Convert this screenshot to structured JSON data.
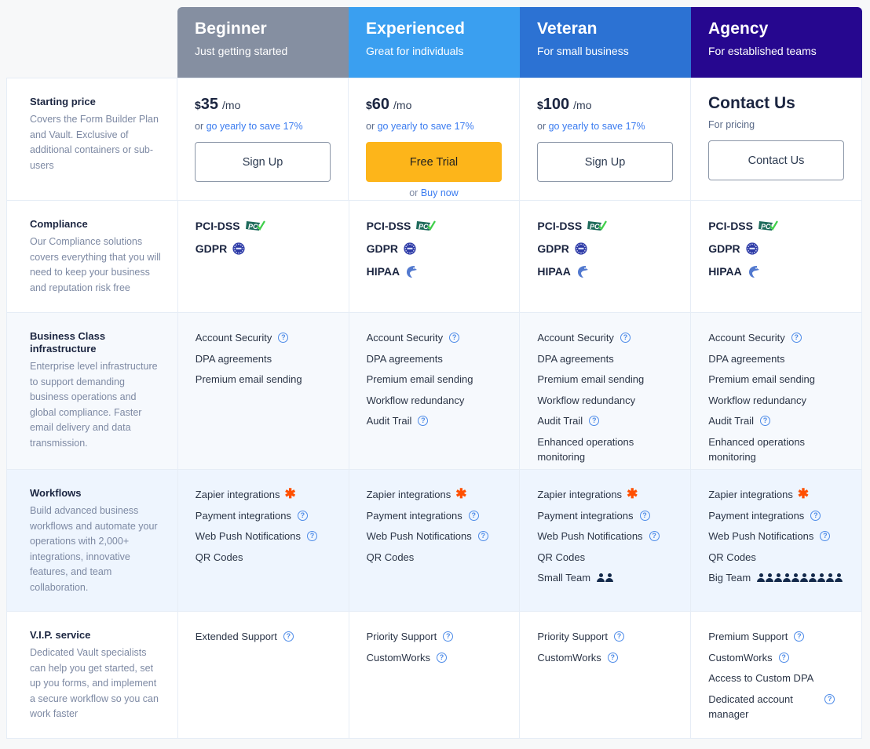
{
  "plans": [
    {
      "name": "Beginner",
      "tagline": "Just getting started",
      "color": "#858fa1",
      "currency": "$",
      "amount": "35",
      "per": "/mo",
      "yearly_prefix": "or",
      "yearly_link": "go yearly to save 17%",
      "button": "Sign Up"
    },
    {
      "name": "Experienced",
      "tagline": "Great for individuals",
      "color": "#3a9ff0",
      "currency": "$",
      "amount": "60",
      "per": "/mo",
      "yearly_prefix": "or",
      "yearly_link": "go yearly to save 17%",
      "button": "Free Trial",
      "buy_prefix": "or",
      "buy_link": "Buy now"
    },
    {
      "name": "Veteran",
      "tagline": "For small business",
      "color": "#2c72d3",
      "currency": "$",
      "amount": "100",
      "per": "/mo",
      "yearly_prefix": "or",
      "yearly_link": "go yearly to save 17%",
      "button": "Sign Up"
    },
    {
      "name": "Agency",
      "tagline": "For established teams",
      "color": "#26078f",
      "contact_title": "Contact Us",
      "for_pricing": "For pricing",
      "button": "Contact Us"
    }
  ],
  "rows": {
    "pricing": {
      "title": "Starting price",
      "desc": "Covers the Form Builder Plan and Vault. Exclusive of additional containers or sub-users"
    },
    "compliance": {
      "title": "Compliance",
      "desc": "Our Compliance solutions covers everything that you will need to keep your business and reputation risk free",
      "labels": {
        "pci": "PCI-DSS",
        "gdpr": "GDPR",
        "hipaa": "HIPAA"
      },
      "icons": {
        "pci": "pci-badge-icon",
        "gdpr": "gdpr-eu-seal-icon",
        "hipaa": "hipaa-eagle-icon"
      }
    },
    "infra": {
      "title": "Business Class infrastructure",
      "desc": "Enterprise level infrastructure to support demanding business operations and global compliance. Faster email delivery and data transmission."
    },
    "workflows": {
      "title": "Workflows",
      "desc": "Build advanced business workflows and automate your operations with 2,000+ integrations, innovative features, and team collaboration."
    },
    "vip": {
      "title": "V.I.P. service",
      "desc": "Dedicated Vault specialists can help you get started, set up you forms, and implement a secure workflow so you can work faster"
    }
  },
  "compliance_columns": [
    [
      "pci",
      "gdpr"
    ],
    [
      "pci",
      "gdpr",
      "hipaa"
    ],
    [
      "pci",
      "gdpr",
      "hipaa"
    ],
    [
      "pci",
      "gdpr",
      "hipaa"
    ]
  ],
  "infra_columns": [
    [
      {
        "label": "Account Security",
        "help": true
      },
      {
        "label": "DPA agreements"
      },
      {
        "label": "Premium email sending"
      }
    ],
    [
      {
        "label": "Account Security",
        "help": true
      },
      {
        "label": "DPA agreements"
      },
      {
        "label": "Premium email sending"
      },
      {
        "label": "Workflow redundancy"
      },
      {
        "label": "Audit Trail",
        "help": true
      }
    ],
    [
      {
        "label": "Account Security",
        "help": true
      },
      {
        "label": "DPA agreements"
      },
      {
        "label": "Premium email sending"
      },
      {
        "label": "Workflow redundancy"
      },
      {
        "label": "Audit Trail",
        "help": true
      },
      {
        "label": "Enhanced operations monitoring"
      }
    ],
    [
      {
        "label": "Account Security",
        "help": true
      },
      {
        "label": "DPA agreements"
      },
      {
        "label": "Premium email sending"
      },
      {
        "label": "Workflow redundancy"
      },
      {
        "label": "Audit Trail",
        "help": true
      },
      {
        "label": "Enhanced operations monitoring"
      }
    ]
  ],
  "workflow_columns": [
    [
      {
        "label": "Zapier integrations",
        "zapier": true
      },
      {
        "label": "Payment integrations",
        "help": true
      },
      {
        "label": "Web Push Notifications",
        "help": true
      },
      {
        "label": "QR Codes"
      }
    ],
    [
      {
        "label": "Zapier integrations",
        "zapier": true
      },
      {
        "label": "Payment integrations",
        "help": true
      },
      {
        "label": "Web Push Notifications",
        "help": true
      },
      {
        "label": "QR Codes"
      }
    ],
    [
      {
        "label": "Zapier integrations",
        "zapier": true
      },
      {
        "label": "Payment integrations",
        "help": true
      },
      {
        "label": "Web Push Notifications",
        "help": true
      },
      {
        "label": "QR Codes"
      },
      {
        "label": "Small Team",
        "people": 2
      }
    ],
    [
      {
        "label": "Zapier integrations",
        "zapier": true
      },
      {
        "label": "Payment integrations",
        "help": true
      },
      {
        "label": "Web Push Notifications",
        "help": true
      },
      {
        "label": "QR Codes"
      },
      {
        "label": "Big Team",
        "people": 10
      }
    ]
  ],
  "vip_columns": [
    [
      {
        "label": "Extended Support",
        "help": true
      }
    ],
    [
      {
        "label": "Priority Support",
        "help": true
      },
      {
        "label": "CustomWorks",
        "help": true
      }
    ],
    [
      {
        "label": "Priority Support",
        "help": true
      },
      {
        "label": "CustomWorks",
        "help": true
      }
    ],
    [
      {
        "label": "Premium Support",
        "help": true
      },
      {
        "label": "CustomWorks",
        "help": true
      },
      {
        "label": "Access to Custom DPA"
      },
      {
        "label": "Dedicated account manager",
        "help": true
      }
    ]
  ],
  "icons": {
    "help": "?",
    "zapier": "✱"
  }
}
